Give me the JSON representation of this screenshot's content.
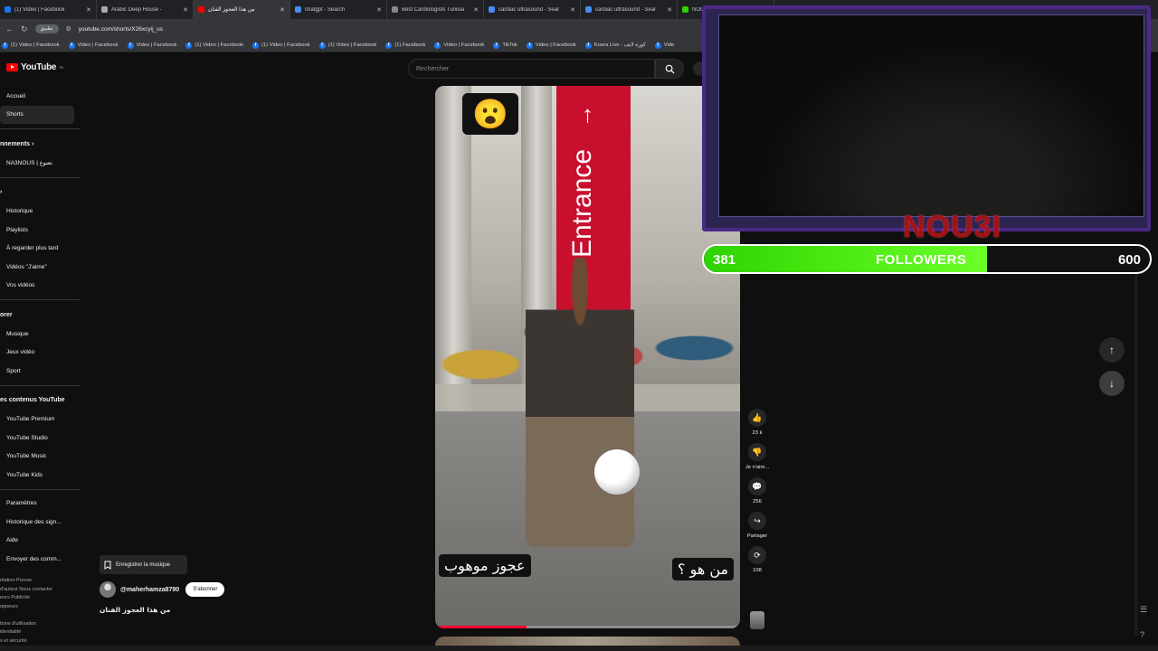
{
  "browser": {
    "tabs": [
      {
        "title": "(1) Video | Facebook",
        "color": "#1877f2",
        "active": false
      },
      {
        "title": "Arabic Deep House -",
        "color": "#aaaaaa",
        "active": false
      },
      {
        "title": "من هذا العجوز الفنان",
        "color": "#ff0000",
        "active": true
      },
      {
        "title": "chatgpt - Search",
        "color": "#4b8bf4",
        "active": false
      },
      {
        "title": "Best Cardiologists Tunisia",
        "color": "#888888",
        "active": false
      },
      {
        "title": "cardiac ultrasound - Sear",
        "color": "#4b8bf4",
        "active": false
      },
      {
        "title": "cardiac ultrasound - Sear",
        "color": "#4b8bf4",
        "active": false
      },
      {
        "title": "NOU3",
        "color": "#2ed400",
        "active": false
      }
    ],
    "address": {
      "chip": "تطبيق",
      "url": "youtube.com/shorts/X26xcyij_us"
    },
    "bookmarks": [
      "(1) Video | Facebook",
      "Video | Facebook",
      "Video | Facebook",
      "(1) Video | Facebook",
      "(1) Video | Facebook",
      "(1) Video | Facebook",
      "(1) Facebook",
      "Video | Facebook",
      "TikTok",
      "Video | Facebook",
      "Koora Live - كورة لايف",
      "Vide"
    ]
  },
  "youtube": {
    "logo": "YouTube",
    "logo_country": "TN",
    "search_placeholder": "Rechercher",
    "sidebar": {
      "main": [
        "Accueil",
        "Shorts"
      ],
      "subscriptions_heading": "nnements",
      "subscriptions": [
        "NA3NOUS | نعنوع"
      ],
      "you_heading": "›",
      "you": [
        "Historique",
        "Playlists",
        "À regarder plus tard",
        "Vidéos \"J'aime\"",
        "Vos vidéos"
      ],
      "explore_heading": "orer",
      "explore": [
        "Musique",
        "Jeux vidéo",
        "Sport"
      ],
      "more_heading": "es contenus YouTube",
      "more": [
        "YouTube Premium",
        "YouTube Studio",
        "YouTube Music",
        "YouTube Kids"
      ],
      "settings": [
        "Paramètres",
        "Historique des sign...",
        "Aide",
        "Envoyer des comm..."
      ],
      "footer": [
        "ntation  Presse",
        "d'auteur  Nous contacter",
        "eurs  Publicité",
        "oppeurs",
        "",
        "tions d'utilisation",
        "identialité",
        "s et sécurité"
      ]
    },
    "short": {
      "caption_left": "عجوز موهوب",
      "caption_right": "من هو ؟",
      "emoji": "😮",
      "banner_text": "Entrance",
      "progress": 0.3
    },
    "actions": [
      {
        "icon": "thumb-up-icon",
        "glyph": "👍",
        "label": "23 k"
      },
      {
        "icon": "thumb-down-icon",
        "glyph": "👎",
        "label": "Je n'aim..."
      },
      {
        "icon": "comment-icon",
        "glyph": "💬",
        "label": "256"
      },
      {
        "icon": "share-icon",
        "glyph": "↪",
        "label": "Partager"
      },
      {
        "icon": "remix-icon",
        "glyph": "⟳",
        "label": "108"
      }
    ],
    "save_music": "Enregistrer la musique",
    "channel": "@maherhamza8790",
    "subscribe": "S'abonner",
    "video_title": "من هذا العجوز الفنان"
  },
  "overlay": {
    "streamer": "NOU3I",
    "followers_current": "381",
    "followers_label": "FOLLOWERS",
    "followers_goal": "600",
    "followers_fraction": 0.635,
    "frame_color": "#4a2a86"
  }
}
